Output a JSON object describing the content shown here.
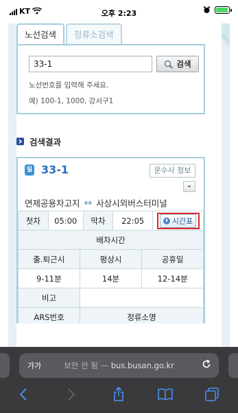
{
  "status_bar": {
    "carrier": "KT",
    "time": "오후 2:23"
  },
  "tabs": [
    {
      "label": "노선검색"
    },
    {
      "label": "정류소검색"
    }
  ],
  "search": {
    "value": "33-1",
    "button_label": "검색",
    "help_line1": "노선번호를 입력해 주세요.",
    "help_line2": "예) 100-1, 1000, 강서구1"
  },
  "results": {
    "title": "검색결과",
    "badge_text": "일",
    "bus_number": "33-1",
    "operator_button": "운수사 정보",
    "collapse_button": "-",
    "route_start": "연제공용차고지",
    "route_arrow": "↔",
    "route_end": "사상시외버스터미널",
    "first_label": "첫차",
    "first_time": "05:00",
    "last_label": "막차",
    "last_time": "22:05",
    "timetable_button": "시간표",
    "interval_header": "배차시간",
    "interval_columns": [
      "출.퇴근시",
      "평상시",
      "공휴일"
    ],
    "interval_values": [
      "9-11분",
      "14분",
      "12-14분"
    ],
    "note_label": "비고",
    "note_value": "",
    "stop_header_1": "ARS번호",
    "stop_header_2": "정류소명"
  },
  "browser": {
    "text_size_label": "가가",
    "security_label": "보안 안 됨",
    "separator": "—",
    "domain": "bus.busan.go.kr"
  },
  "colors": {
    "accent": "#2b6fbf",
    "frame": "#a8cddd",
    "highlight": "#d9272d",
    "browser_bg": "#3a3a3c"
  }
}
